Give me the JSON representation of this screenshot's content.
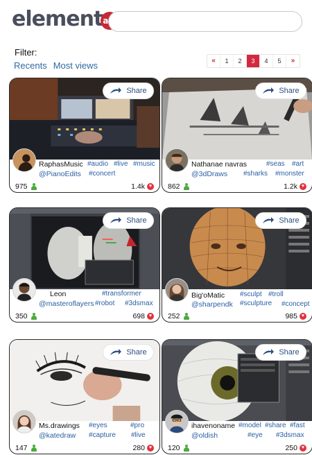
{
  "header": {
    "logo_word": "element",
    "logo_badge": "art",
    "search_placeholder": ""
  },
  "filter": {
    "label": "Filter:",
    "options": [
      "Recents",
      "Most views"
    ]
  },
  "pagination": {
    "prev": "«",
    "pages": [
      "1",
      "2",
      "3",
      "4",
      "5"
    ],
    "current": "3",
    "next": "»"
  },
  "share_label": "Share",
  "colors": {
    "brand": "#c62a36",
    "link": "#2a5ea3",
    "views_icon": "#4caa3d",
    "likes_icon": "#e2333d"
  },
  "cards": [
    {
      "username": "RaphasMusic",
      "handle": "@PianoEdits",
      "tags_row1": [
        "#audio",
        "#live",
        "#music"
      ],
      "tags_row2": [
        "#concert"
      ],
      "views": "975",
      "likes": "1.4k",
      "thumb": "studio-mixing-desk"
    },
    {
      "username": "Nathanae navras",
      "handle": "@3dDraws",
      "tags_row1": [
        "#seas",
        "#art"
      ],
      "tags_row2": [
        "#sharks",
        "#monster"
      ],
      "views": "862",
      "likes": "1.2k",
      "thumb": "pencil-drawing-sharks"
    },
    {
      "username": "Leon",
      "handle": "@masteroflayers",
      "tags_row1": [
        "#transformer"
      ],
      "tags_row2": [
        "#robot",
        "#3dsmax"
      ],
      "views": "350",
      "likes": "698",
      "thumb": "3d-robot-render"
    },
    {
      "username": "Big'oMatic",
      "handle": "@sharpendk",
      "tags_row1": [
        "#sculpt",
        "#troll"
      ],
      "tags_row2": [
        "#sculpture",
        "#concept"
      ],
      "views": "252",
      "likes": "985",
      "thumb": "3d-head-sculpt"
    },
    {
      "username": "Ms.drawings",
      "handle": "@katedraw",
      "tags_row1": [
        "#eyes",
        "#pro"
      ],
      "tags_row2": [
        "#capture",
        "#live"
      ],
      "views": "147",
      "likes": "280",
      "thumb": "eye-sketch-drawing"
    },
    {
      "username": "ihavenoname",
      "handle": "@oldish",
      "tags_row1": [
        "#model",
        "#share",
        "#fast"
      ],
      "tags_row2": [
        "#eye",
        "#3dsmax"
      ],
      "views": "120",
      "likes": "250",
      "thumb": "3d-eyeball-model"
    }
  ]
}
